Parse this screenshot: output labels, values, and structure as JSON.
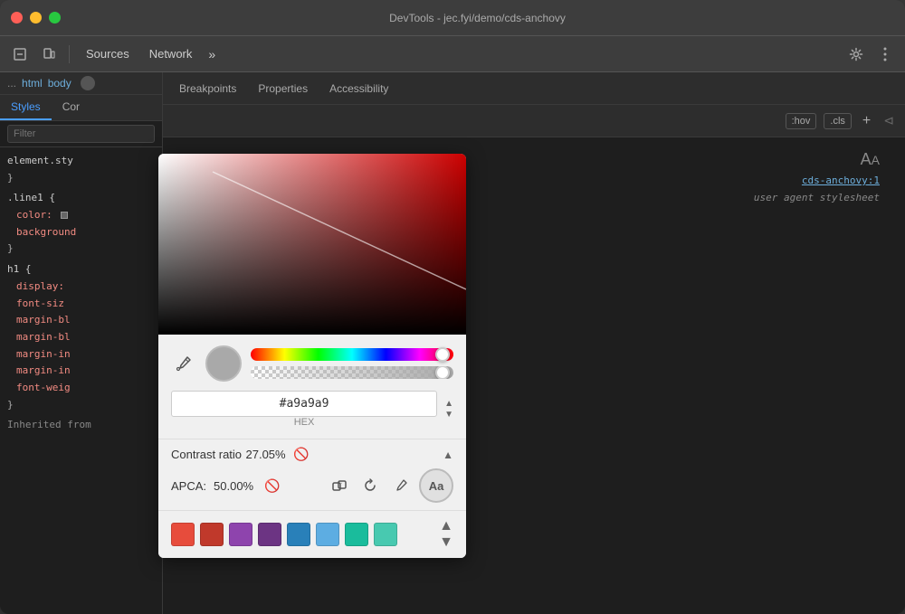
{
  "window": {
    "title": "DevTools - jec.fyi/demo/cds-anchovy"
  },
  "titlebar": {
    "title": "DevTools - jec.fyi/demo/cds-anchovy"
  },
  "tabs": {
    "sources": "Sources",
    "network": "Network",
    "more": "»"
  },
  "breadcrumb": {
    "html": "html",
    "body": "body"
  },
  "style_tabs": {
    "styles": "Styles",
    "computed": "Cor"
  },
  "filter": {
    "placeholder": "Filter"
  },
  "css_rules": [
    {
      "selector": "element.sty",
      "brace_open": "{",
      "brace_close": "}"
    },
    {
      "selector": ".line1 {",
      "properties": [
        {
          "name": "color:",
          "value": "■"
        },
        {
          "name": "background",
          "value": ""
        }
      ],
      "brace_close": "}"
    },
    {
      "selector": "h1 {",
      "properties": [
        {
          "name": "display:",
          "value": ""
        },
        {
          "name": "font-siz",
          "value": ""
        },
        {
          "name": "margin-bl",
          "value": ""
        },
        {
          "name": "margin-bl",
          "value": ""
        },
        {
          "name": "margin-in",
          "value": ""
        },
        {
          "name": "margin-in",
          "value": ""
        },
        {
          "name": "font-weig",
          "value": ""
        }
      ],
      "brace_close": "}"
    }
  ],
  "inherited_text": "Inherited from",
  "color_picker": {
    "hex_value": "#a9a9a9",
    "hex_label": "HEX",
    "contrast_label": "Contrast ratio",
    "contrast_value": "27.05%",
    "apca_label": "APCA:",
    "apca_value": "50.00%",
    "aa_badge": "Aa",
    "swatches": [
      "#e74c3c",
      "#c0392b",
      "#8e44ad",
      "#6c3483",
      "#2980b9",
      "#5dade2",
      "#1abc9c",
      "#48c9b0"
    ]
  },
  "right_panel": {
    "tabs": [
      "Breakpoints",
      "Properties",
      "Accessibility"
    ],
    "hov_btn": ":hov",
    "cls_btn": ".cls",
    "add_btn": "+",
    "aa_size": "AA",
    "source_link": "cds-anchovy:1",
    "user_agent": "user agent stylesheet"
  },
  "icons": {
    "cursor": "⬚",
    "device": "◱",
    "settings": "⚙",
    "menu": "⋮",
    "eyedropper": "✒",
    "copy_link": "🔗",
    "eyedropper2": "✒",
    "refresh": "↻"
  }
}
